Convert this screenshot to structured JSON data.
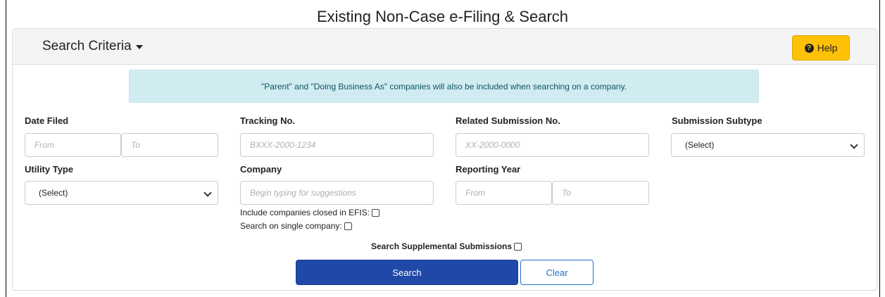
{
  "page": {
    "title": "Existing Non-Case e-Filing & Search"
  },
  "header": {
    "criteria_label": "Search Criteria",
    "help_label": "Help"
  },
  "info": {
    "message": "\"Parent\" and \"Doing Business As\" companies will also be included when searching on a company."
  },
  "fields": {
    "date_filed": {
      "label": "Date Filed",
      "from_placeholder": "From",
      "to_placeholder": "To"
    },
    "tracking_no": {
      "label": "Tracking No.",
      "placeholder": "BXXX-2000-1234"
    },
    "related_submission": {
      "label": "Related Submission No.",
      "placeholder": "XX-2000-0000"
    },
    "submission_subtype": {
      "label": "Submission Subtype",
      "value": "(Select)"
    },
    "utility_type": {
      "label": "Utility Type",
      "value": "(Select)"
    },
    "company": {
      "label": "Company",
      "placeholder": "Begin typing for suggestions"
    },
    "reporting_year": {
      "label": "Reporting Year",
      "from_placeholder": "From",
      "to_placeholder": "To"
    }
  },
  "checkboxes": {
    "include_closed": "Include companies closed in EFIS:",
    "single_company": "Search on single company:",
    "supplemental": "Search Supplemental Submissions"
  },
  "actions": {
    "search_label": "Search",
    "clear_label": "Clear"
  },
  "colors": {
    "help_bg": "#ffc107",
    "alert_bg": "#d1ecf1",
    "alert_text": "#0c5460",
    "search_bg": "#1f48a8",
    "clear_border": "#1f6fd0"
  }
}
